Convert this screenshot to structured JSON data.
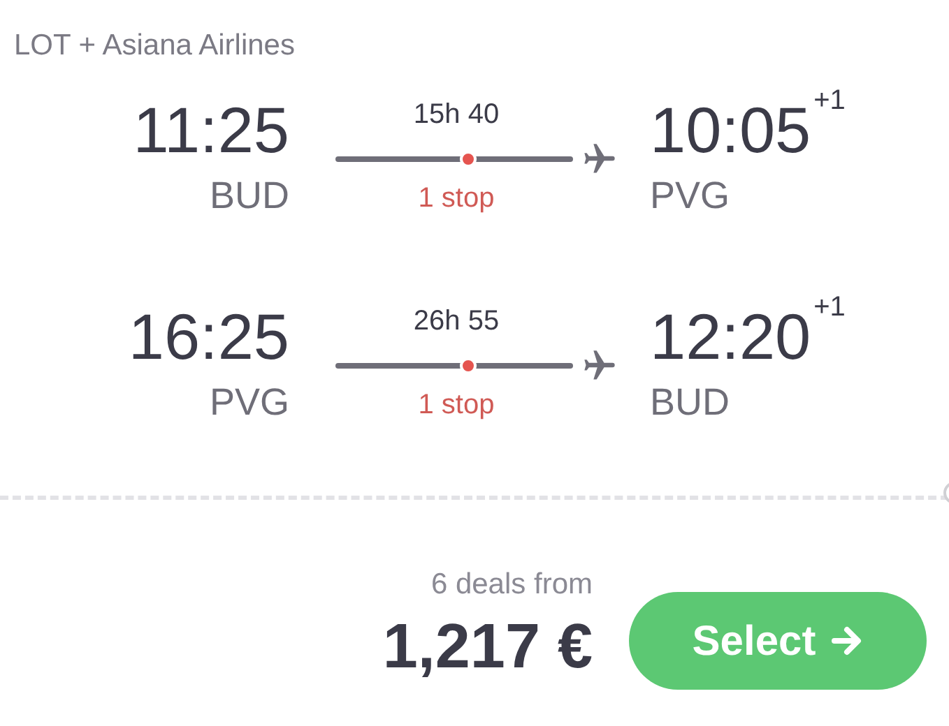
{
  "airline": "LOT + Asiana Airlines",
  "legs": [
    {
      "departure_time": "11:25",
      "departure_airport": "BUD",
      "duration": "15h 40",
      "stops": "1 stop",
      "arrival_time": "10:05",
      "day_offset": "+1",
      "arrival_airport": "PVG"
    },
    {
      "departure_time": "16:25",
      "departure_airport": "PVG",
      "duration": "26h 55",
      "stops": "1 stop",
      "arrival_time": "12:20",
      "day_offset": "+1",
      "arrival_airport": "BUD"
    }
  ],
  "price": {
    "deals": "6 deals from",
    "amount": "1,217 €"
  },
  "select_button": {
    "label": "Select"
  }
}
